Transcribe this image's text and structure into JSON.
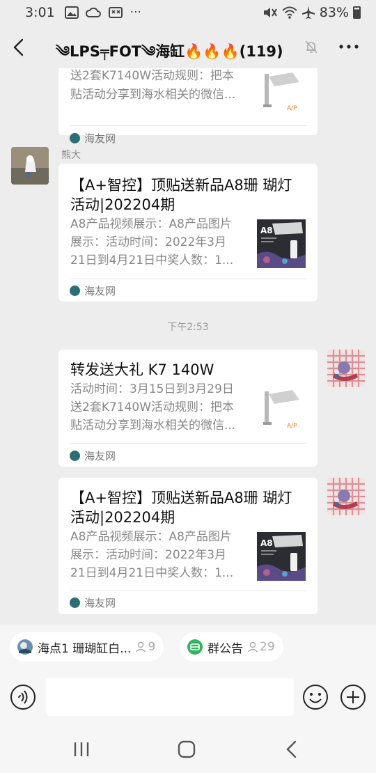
{
  "status_bar": {
    "time": "3:01",
    "dots": "···",
    "battery": "83%"
  },
  "header": {
    "title": "༄LPS╤FOT༄海缸🔥🔥🔥(119)"
  },
  "messages": {
    "card_top": {
      "desc1": "送2套K7140W活动规则：把本",
      "desc2": "贴活动分享到海水相关的微信...",
      "source": "海友网"
    },
    "sender_name": "熊大",
    "card_a8_1": {
      "title1": "【A+智控】顶贴送新品A8珊 瑚灯",
      "title2": "活动|202204期",
      "desc1": "A8产品视频展示：A8产品图片",
      "desc2": "展示：活动时间：2022年3月",
      "desc3": "21日到4月21日中奖人数：1...",
      "source": "海友网"
    },
    "timestamp": "下午2:53",
    "card_k7": {
      "title1": "转发送大礼  K7 140W",
      "desc1": "活动时间：3月15日到3月29日",
      "desc2": "送2套K7140W活动规则：把本",
      "desc3": "贴活动分享到海水相关的微信...",
      "source": "海友网"
    },
    "card_a8_2": {
      "title1": "【A+智控】顶贴送新品A8珊 瑚灯",
      "title2": "活动|202204期",
      "desc1": "A8产品视频展示：A8产品图片",
      "desc2": "展示：活动时间：2022年3月",
      "desc3": "21日到4月21日中奖人数：1...",
      "source": "海友网"
    }
  },
  "chips": [
    {
      "label": "海点1 珊瑚缸白...",
      "count": "9"
    },
    {
      "label": "群公告",
      "count": "29"
    }
  ],
  "input": {
    "placeholder": ""
  },
  "colors": {
    "source_logo": "#2c6e73",
    "notice_green": "#2fb55d",
    "background": "#ededed"
  }
}
